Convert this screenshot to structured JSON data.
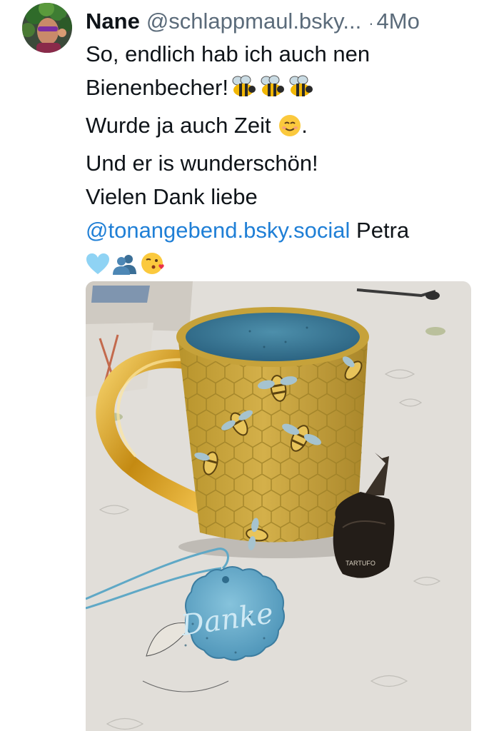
{
  "post": {
    "author": {
      "display_name": "Nane",
      "handle": "@schlappmaul.bsky...",
      "avatar_icon": "avatar-photo-icon"
    },
    "separator": "·",
    "timestamp": "4Mo",
    "text": {
      "line1": "So, endlich hab ich auch nen",
      "line2": "Bienenbecher!",
      "line2_emojis": [
        "honeybee-emoji",
        "honeybee-emoji",
        "honeybee-emoji"
      ],
      "line3": "Wurde ja auch Zeit",
      "line3_emoji": "smiling-face-emoji",
      "line3_end": ".",
      "line4": "Und er is wunderschön!",
      "line5": "Vielen Dank liebe",
      "mention": "@tonangebend.bsky.social",
      "after_mention": " Petra",
      "line7_emojis": [
        "light-blue-heart-emoji",
        "busts-in-silhouette-emoji",
        "face-blowing-kiss-emoji"
      ]
    },
    "media": {
      "medallion_text": "Danke",
      "chocolate_wrapper_text": "TARTUFO"
    }
  },
  "colors": {
    "text": "#0f1419",
    "secondary": "#5b6b7a",
    "link": "#1f7fd6",
    "mug_yellow": "#c9a53a",
    "mug_glaze_blue": "#3f7f9c",
    "handle_gold": "#d4a41c"
  }
}
